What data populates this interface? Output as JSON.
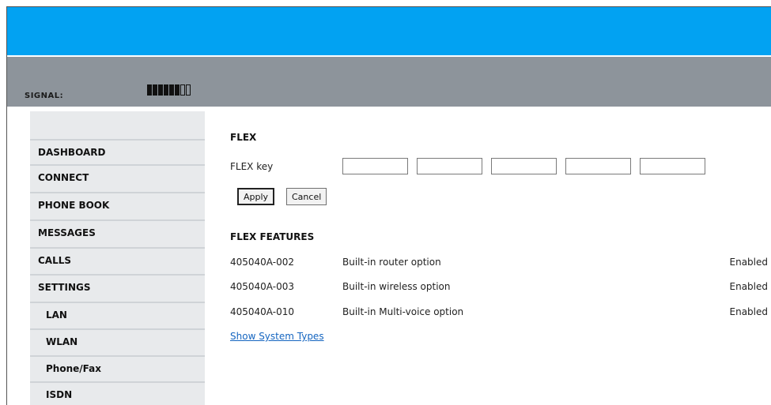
{
  "header": {
    "signal_label": "SIGNAL:",
    "signal_bars": {
      "filled": 6,
      "total": 8
    }
  },
  "sidebar": {
    "items": [
      {
        "label": "DASHBOARD",
        "sub": false
      },
      {
        "label": "CONNECT",
        "sub": false
      },
      {
        "label": "PHONE BOOK",
        "sub": false
      },
      {
        "label": "MESSAGES",
        "sub": false
      },
      {
        "label": "CALLS",
        "sub": false
      },
      {
        "label": "SETTINGS",
        "sub": false
      },
      {
        "label": "LAN",
        "sub": true
      },
      {
        "label": "WLAN",
        "sub": true
      },
      {
        "label": "Phone/Fax",
        "sub": true
      },
      {
        "label": "ISDN",
        "sub": true
      }
    ]
  },
  "flex": {
    "title": "FLEX",
    "key_label": "FLEX key",
    "key_fields": [
      "",
      "",
      "",
      "",
      ""
    ],
    "apply_label": "Apply",
    "cancel_label": "Cancel"
  },
  "features": {
    "title": "FLEX FEATURES",
    "rows": [
      {
        "code": "405040A-002",
        "description": "Built-in router option",
        "status": "Enabled"
      },
      {
        "code": "405040A-003",
        "description": "Built-in wireless option",
        "status": "Enabled"
      },
      {
        "code": "405040A-010",
        "description": "Built-in Multi-voice option",
        "status": "Enabled"
      }
    ]
  },
  "links": {
    "show_system_types": "Show System Types"
  },
  "colors": {
    "header_blue": "#02a2f2",
    "status_gray": "#8d949b",
    "sidebar_bg": "#e8eaec",
    "link_blue": "#1565c0"
  }
}
